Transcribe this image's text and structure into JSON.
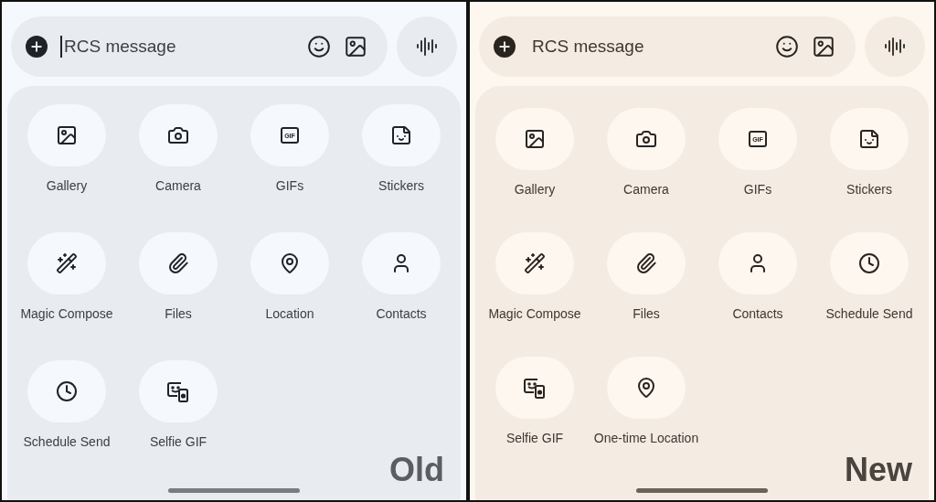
{
  "panels": [
    {
      "kind": "cool",
      "composer": {
        "placeholder": "RCS message",
        "caret": true
      },
      "attachments": [
        {
          "kind": "gallery",
          "label": "Gallery"
        },
        {
          "kind": "camera",
          "label": "Camera"
        },
        {
          "kind": "gif",
          "label": "GIFs",
          "glyph": "GIF"
        },
        {
          "kind": "sticker",
          "label": "Stickers"
        },
        {
          "kind": "compose",
          "label": "Magic Compose"
        },
        {
          "kind": "files",
          "label": "Files"
        },
        {
          "kind": "location",
          "label": "Location"
        },
        {
          "kind": "contact",
          "label": "Contacts"
        },
        {
          "kind": "schedule",
          "label": "Schedule Send"
        },
        {
          "kind": "selfie",
          "label": "Selfie GIF"
        }
      ],
      "caption": "Old"
    },
    {
      "kind": "warm",
      "composer": {
        "placeholder": "RCS message",
        "caret": false
      },
      "attachments": [
        {
          "kind": "gallery",
          "label": "Gallery"
        },
        {
          "kind": "camera",
          "label": "Camera"
        },
        {
          "kind": "gif",
          "label": "GIFs",
          "glyph": "GIF"
        },
        {
          "kind": "sticker",
          "label": "Stickers"
        },
        {
          "kind": "compose",
          "label": "Magic Compose"
        },
        {
          "kind": "files",
          "label": "Files"
        },
        {
          "kind": "contact",
          "label": "Contacts"
        },
        {
          "kind": "schedule",
          "label": "Schedule Send"
        },
        {
          "kind": "selfie",
          "label": "Selfie GIF"
        },
        {
          "kind": "location",
          "label": "One-time Location"
        }
      ],
      "caption": "New"
    }
  ]
}
